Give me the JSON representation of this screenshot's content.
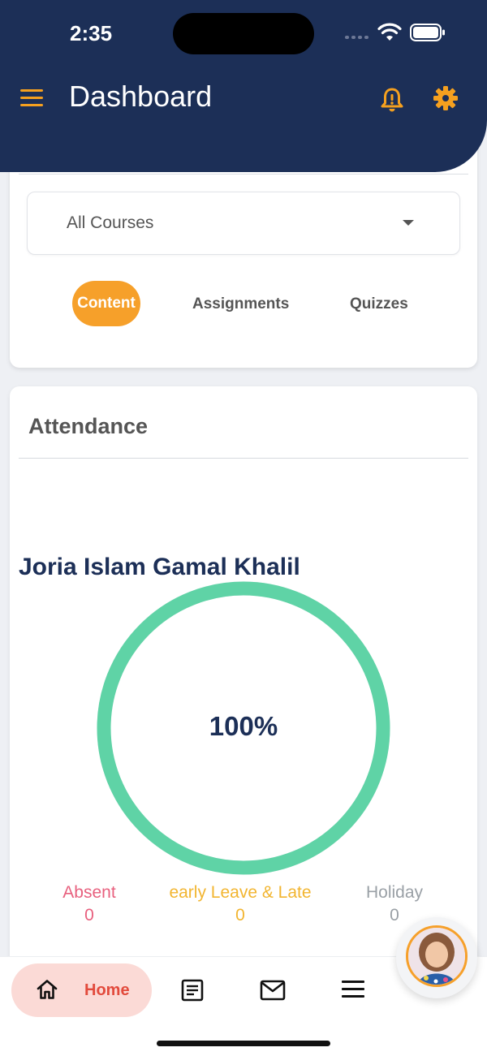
{
  "status_bar": {
    "time": "2:35"
  },
  "header": {
    "title": "Dashboard",
    "icons": {
      "menu": "hamburger-menu-icon",
      "notifications": "bell-alert-icon",
      "settings": "gear-icon"
    },
    "accent_color": "#f5a01f",
    "background_color": "#1c2f57"
  },
  "filter": {
    "course_select": {
      "value": "All Courses"
    },
    "tabs": [
      {
        "label": "Content",
        "active": true
      },
      {
        "label": "Assignments",
        "active": false
      },
      {
        "label": "Quizzes",
        "active": false
      }
    ]
  },
  "attendance": {
    "title": "Attendance",
    "student_name": "Joria Islam Gamal Khalil",
    "percent_label": "100%",
    "percent_value": 100,
    "ring_color": "#5fd3a6",
    "legend": [
      {
        "label": "Absent",
        "value": "0",
        "color": "#e8607e"
      },
      {
        "label": "early Leave & Late",
        "value": "0",
        "color": "#f2b530"
      },
      {
        "label": "Holiday",
        "value": "0",
        "color": "#9aa0a6"
      }
    ]
  },
  "bottom_nav": {
    "items": [
      {
        "label": "Home",
        "icon": "home-icon",
        "active": true
      },
      {
        "icon": "document-icon"
      },
      {
        "icon": "mail-icon"
      },
      {
        "icon": "menu-icon"
      }
    ]
  }
}
